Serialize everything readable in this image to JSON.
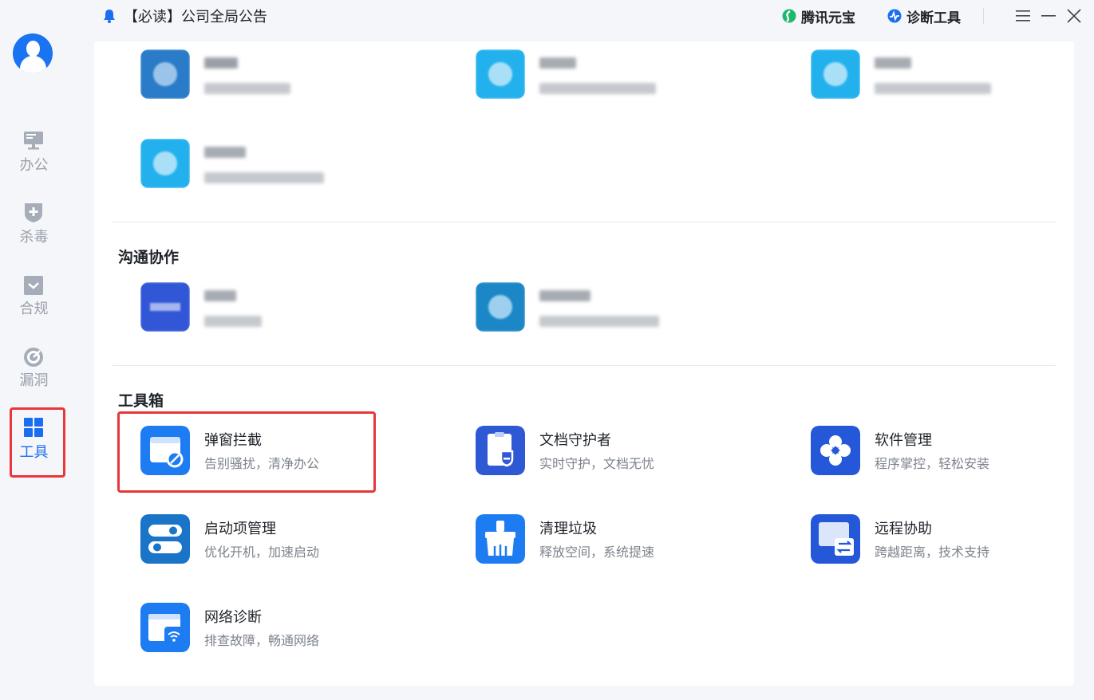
{
  "sidebar": {
    "items": [
      {
        "label": "办公",
        "icon": "monitor-icon",
        "active": false
      },
      {
        "label": "杀毒",
        "icon": "shield-plus-icon",
        "active": false
      },
      {
        "label": "合规",
        "icon": "checkbox-icon",
        "active": false
      },
      {
        "label": "漏洞",
        "icon": "radar-icon",
        "active": false
      },
      {
        "label": "工具",
        "icon": "grid-icon",
        "active": true
      }
    ]
  },
  "titlebar": {
    "notice": "【必读】公司全局公告",
    "links": [
      {
        "label": "腾讯元宝",
        "icon": "yuanbao-icon"
      },
      {
        "label": "诊断工具",
        "icon": "diagnose-icon"
      }
    ]
  },
  "sections": {
    "collab_title": "沟通协作",
    "toolbox_title": "工具箱"
  },
  "toolbox": {
    "items": [
      {
        "name": "弹窗拦截",
        "desc": "告别骚扰，清净办公",
        "icon": "popup-block-icon"
      },
      {
        "name": "文档守护者",
        "desc": "实时守护，文档无忧",
        "icon": "doc-guard-icon"
      },
      {
        "name": "软件管理",
        "desc": "程序掌控，轻松安装",
        "icon": "software-manager-icon"
      },
      {
        "name": "启动项管理",
        "desc": "优化开机，加速启动",
        "icon": "startup-toggle-icon"
      },
      {
        "name": "清理垃圾",
        "desc": "释放空间，系统提速",
        "icon": "broom-icon"
      },
      {
        "name": "远程协助",
        "desc": "跨越距离，技术支持",
        "icon": "remote-assist-icon"
      },
      {
        "name": "网络诊断",
        "desc": "排查故障，畅通网络",
        "icon": "network-diagnose-icon"
      }
    ]
  },
  "colors": {
    "accent": "#1a6ff0",
    "highlight": "#e8363a",
    "inactive_nav": "#9aa0aa"
  }
}
